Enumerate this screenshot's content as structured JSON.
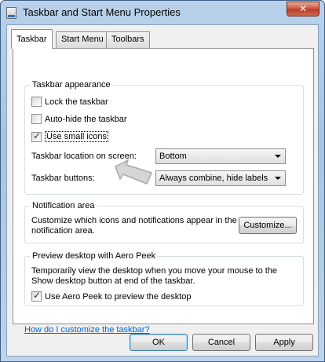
{
  "window": {
    "title": "Taskbar and Start Menu Properties",
    "close_glyph": "✕"
  },
  "tabs": [
    {
      "label": "Taskbar",
      "active": true
    },
    {
      "label": "Start Menu",
      "active": false
    },
    {
      "label": "Toolbars",
      "active": false
    }
  ],
  "appearance": {
    "title": "Taskbar appearance",
    "lock": {
      "label": "Lock the taskbar",
      "checked": false
    },
    "autohide": {
      "label": "Auto-hide the taskbar",
      "checked": false
    },
    "small_icons": {
      "label": "Use small icons",
      "checked": true
    },
    "location_label": "Taskbar location on screen:",
    "location_value": "Bottom",
    "buttons_label": "Taskbar buttons:",
    "buttons_value": "Always combine, hide labels"
  },
  "notification": {
    "title": "Notification area",
    "text": "Customize which icons and notifications appear in the notification area.",
    "customize_label": "Customize..."
  },
  "peek": {
    "title": "Preview desktop with Aero Peek",
    "text": "Temporarily view the desktop when you move your mouse to the Show desktop button at end of the taskbar.",
    "checkbox": {
      "label": "Use Aero Peek to preview the desktop",
      "checked": true
    }
  },
  "help_link": "How do I customize the taskbar?",
  "footer": {
    "ok": "OK",
    "cancel": "Cancel",
    "apply": "Apply"
  }
}
